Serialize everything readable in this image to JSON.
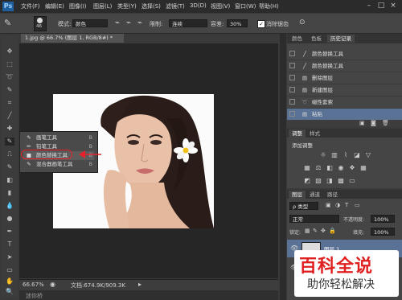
{
  "app": {
    "logo": "Ps",
    "menu": [
      "文件(F)",
      "编辑(E)",
      "图像(I)",
      "图层(L)",
      "类型(Y)",
      "选择(S)",
      "滤镜(T)",
      "3D(D)",
      "视图(V)",
      "窗口(W)",
      "帮助(H)"
    ],
    "window_controls": [
      "–",
      "□",
      "×"
    ]
  },
  "options": {
    "brush_size": "46",
    "mode_label": "模式:",
    "mode_value": "颜色",
    "limits_label": "限制:",
    "limits_value": "连续",
    "tolerance_label": "容差:",
    "tolerance_value": "30%",
    "antialias_label": "消除锯齿"
  },
  "document": {
    "tab_label": "1.jpg @ 66.7% (图层 1, RGB/8#) *",
    "zoom": "66.67%",
    "doc_info": "文档:674.9K/909.3K"
  },
  "flyout": {
    "items": [
      {
        "label": "画笔工具",
        "shortcut": "B"
      },
      {
        "label": "铅笔工具",
        "shortcut": "B"
      },
      {
        "label": "颜色替换工具",
        "shortcut": "B"
      },
      {
        "label": "混合器画笔工具",
        "shortcut": "B"
      }
    ]
  },
  "history": {
    "tabs": [
      "颜色",
      "色板",
      "历史记录"
    ],
    "rows": [
      {
        "icon": "brush-icon",
        "label": "颜色替换工具"
      },
      {
        "icon": "brush-icon",
        "label": "颜色替换工具"
      },
      {
        "icon": "doc-icon",
        "label": "删除图层"
      },
      {
        "icon": "doc-icon",
        "label": "新建图层"
      },
      {
        "icon": "lasso-icon",
        "label": "磁性套索"
      },
      {
        "icon": "doc-icon",
        "label": "粘贴"
      }
    ]
  },
  "adjustments": {
    "tabs": [
      "调整",
      "样式"
    ],
    "title": "添加调整"
  },
  "layers": {
    "tabs": [
      "图层",
      "通道",
      "路径"
    ],
    "filter_label": "ρ 类型",
    "blend_mode": "正常",
    "opacity_label": "不透明度:",
    "opacity_value": "100%",
    "lock_label": "锁定:",
    "fill_label": "填充:",
    "fill_value": "100%",
    "layer_name": "图层 1"
  },
  "watermark": {
    "line1": "百科全说",
    "line2": "助你轻松解决"
  },
  "bottom_tab": "迷你桥",
  "colors": {
    "accent_red": "#e8222a",
    "selection_blue": "#5a7296",
    "watermark_text": "#e02020"
  }
}
